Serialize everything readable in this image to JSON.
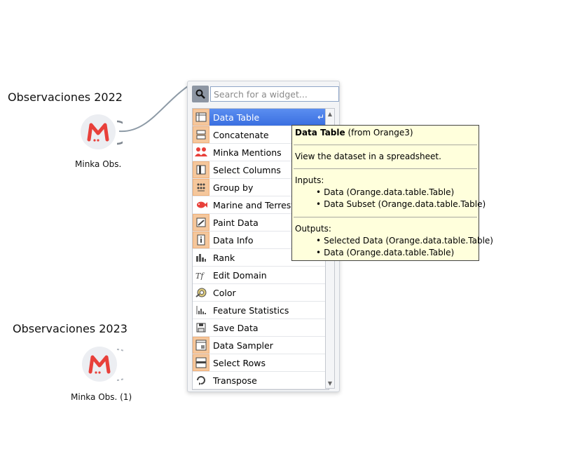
{
  "canvas": {
    "annotations": [
      "Observaciones 2022",
      "Observaciones 2023"
    ],
    "nodes": [
      {
        "label": "Minka Obs.",
        "icon": "minka-logo-icon"
      },
      {
        "label": "Minka Obs. (1)",
        "icon": "minka-logo-icon"
      }
    ]
  },
  "menu": {
    "search": {
      "placeholder": "Search for a widget..."
    },
    "items": [
      {
        "label": "Data Table",
        "icon": "data-table-icon",
        "selected": true
      },
      {
        "label": "Concatenate",
        "icon": "concatenate-icon"
      },
      {
        "label": "Minka Mentions",
        "icon": "minka-mentions-icon"
      },
      {
        "label": "Select Columns",
        "icon": "select-columns-icon"
      },
      {
        "label": "Group by",
        "icon": "group-by-icon"
      },
      {
        "label": "Marine and Terrestrial",
        "icon": "fish-icon"
      },
      {
        "label": "Paint Data",
        "icon": "paint-data-icon"
      },
      {
        "label": "Data Info",
        "icon": "data-info-icon"
      },
      {
        "label": "Rank",
        "icon": "rank-icon"
      },
      {
        "label": "Edit Domain",
        "icon": "edit-domain-icon"
      },
      {
        "label": "Color",
        "icon": "color-icon"
      },
      {
        "label": "Feature Statistics",
        "icon": "feature-statistics-icon"
      },
      {
        "label": "Save Data",
        "icon": "save-data-icon"
      },
      {
        "label": "Data Sampler",
        "icon": "data-sampler-icon"
      },
      {
        "label": "Select Rows",
        "icon": "select-rows-icon"
      },
      {
        "label": "Transpose",
        "icon": "transpose-icon"
      }
    ],
    "return_glyph": "↵"
  },
  "tooltip": {
    "title": "Data Table",
    "source": " (from Orange3)",
    "description": "View the dataset in a spreadsheet.",
    "inputs_heading": "Inputs:",
    "inputs": [
      "Data (Orange.data.table.Table)",
      "Data Subset (Orange.data.table.Table)"
    ],
    "outputs_heading": "Outputs:",
    "outputs": [
      "Selected Data (Orange.data.table.Table)",
      "Data (Orange.data.table.Table)"
    ]
  },
  "colors": {
    "selection": "#3a6fe0",
    "tooltip_bg": "#ffffdc",
    "widget_accent": "#f5c79c",
    "minka_red": "#e8403a"
  }
}
